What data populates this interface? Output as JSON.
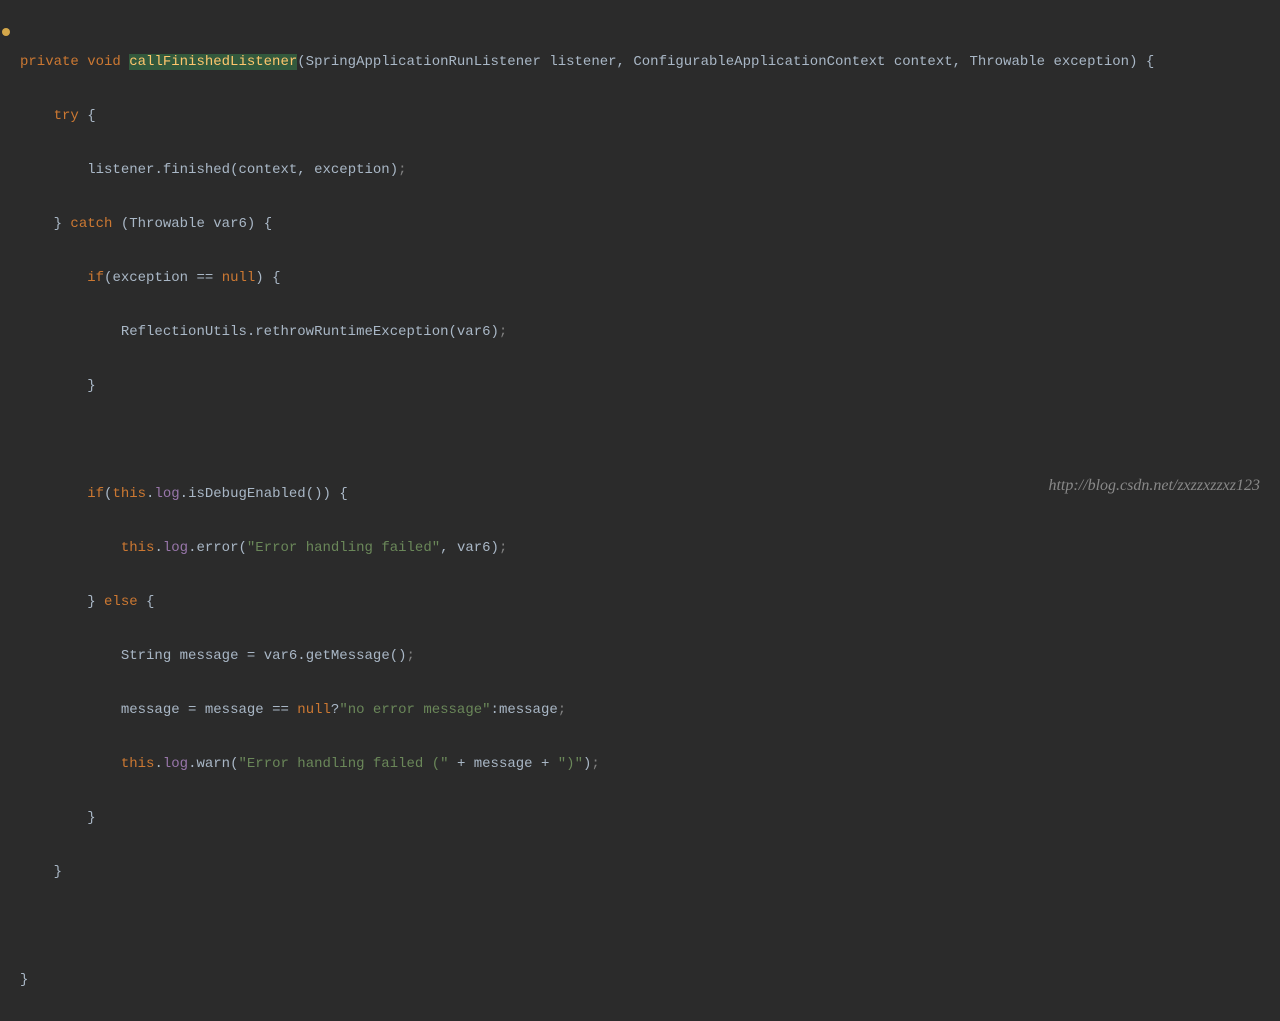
{
  "code": {
    "l1": {
      "private": "private",
      "void": "void",
      "method": "callFinishedListener",
      "param1_type": "SpringApplicationRunListener",
      "param1_name": "listener",
      "param2_type": "ConfigurableApplicationContext",
      "param2_name": "context",
      "param3_type": "Throwable",
      "param3_name": "exception"
    },
    "l2": {
      "try": "try"
    },
    "l3": {
      "listener": "listener",
      "finished": "finished",
      "context": "context",
      "exception": "exception"
    },
    "l4": {
      "catch": "catch",
      "type": "Throwable",
      "var": "var6"
    },
    "l5": {
      "if": "if",
      "exception": "exception",
      "null": "null"
    },
    "l6": {
      "class": "ReflectionUtils",
      "method": "rethrowRuntimeException",
      "arg": "var6"
    },
    "l7": {
      "if": "if",
      "this": "this",
      "log": "log",
      "method": "isDebugEnabled"
    },
    "l8": {
      "this": "this",
      "log": "log",
      "method": "error",
      "string": "\"Error handling failed\"",
      "arg": "var6"
    },
    "l9": {
      "else": "else"
    },
    "l10": {
      "type": "String",
      "var": "message",
      "src": "var6",
      "method": "getMessage"
    },
    "l11": {
      "message1": "message",
      "message2": "message",
      "null": "null",
      "string": "\"no error message\"",
      "message3": "message"
    },
    "l12": {
      "this": "this",
      "log": "log",
      "method": "warn",
      "string1": "\"Error handling failed (\"",
      "var": "message",
      "string2": "\")\""
    }
  },
  "watermark": "http://blog.csdn.net/zxzzxzzxz123"
}
